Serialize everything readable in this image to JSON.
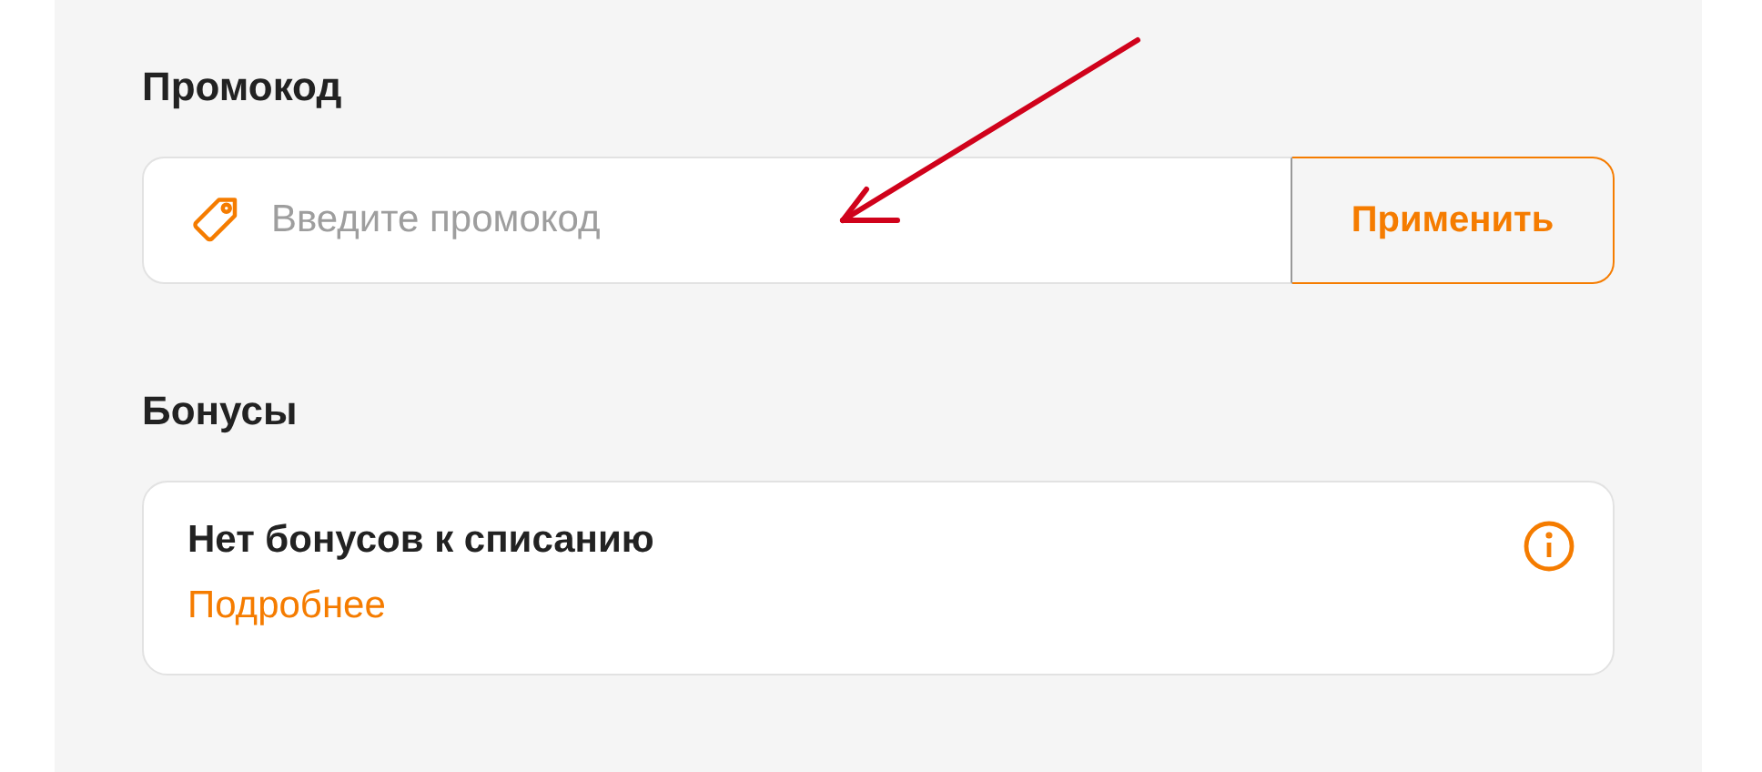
{
  "promo": {
    "title": "Промокод",
    "placeholder": "Введите промокод",
    "button": "Применить"
  },
  "bonuses": {
    "title": "Бонусы",
    "message": "Нет бонусов к списанию",
    "link": "Подробнее"
  },
  "annotation": {
    "kind": "arrow"
  }
}
